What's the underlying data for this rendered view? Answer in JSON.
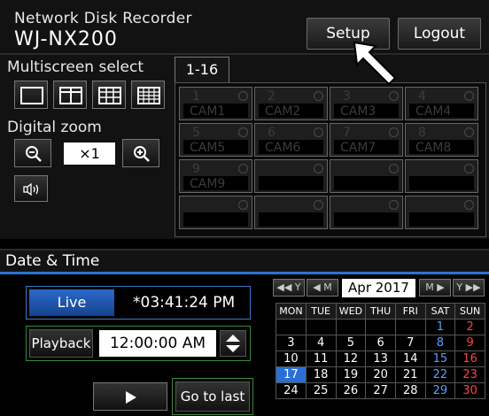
{
  "header": {
    "subtitle": "Network Disk Recorder",
    "title": "WJ-NX200",
    "setup_label": "Setup",
    "logout_label": "Logout"
  },
  "multiscreen": {
    "title": "Multiscreen select",
    "options": [
      "1-screen",
      "4-screen",
      "9-screen",
      "16-screen"
    ]
  },
  "digital_zoom": {
    "title": "Digital zoom",
    "value": "×1"
  },
  "camera_grid": {
    "tab_label": "1-16",
    "cells": [
      {
        "num": "1",
        "cam": "CAM1"
      },
      {
        "num": "2",
        "cam": "CAM2"
      },
      {
        "num": "3",
        "cam": "CAM3"
      },
      {
        "num": "4",
        "cam": "CAM4"
      },
      {
        "num": "5",
        "cam": "CAM5"
      },
      {
        "num": "6",
        "cam": "CAM6"
      },
      {
        "num": "7",
        "cam": "CAM7"
      },
      {
        "num": "8",
        "cam": "CAM8"
      },
      {
        "num": "9",
        "cam": "CAM9"
      },
      {
        "num": "",
        "cam": ""
      },
      {
        "num": "",
        "cam": ""
      },
      {
        "num": "",
        "cam": ""
      },
      {
        "num": "",
        "cam": ""
      },
      {
        "num": "",
        "cam": ""
      },
      {
        "num": "",
        "cam": ""
      },
      {
        "num": "",
        "cam": ""
      }
    ]
  },
  "date_time": {
    "title": "Date & Time",
    "live_label": "Live",
    "live_time": "*03:41:24 PM",
    "playback_label": "Playback",
    "playback_time": "12:00:00 AM",
    "go_to_last_label": "Go to last"
  },
  "calendar": {
    "prev_year": "◀◀ Y",
    "prev_month": "◀ M",
    "month_year": "Apr 2017",
    "next_month": "M ▶",
    "next_year": "Y ▶▶",
    "weekdays": [
      "MON",
      "TUE",
      "WED",
      "THU",
      "FRI",
      "SAT",
      "SUN"
    ],
    "weeks": [
      [
        "",
        "",
        "",
        "",
        "",
        "1",
        "2"
      ],
      [
        "3",
        "4",
        "5",
        "6",
        "7",
        "8",
        "9"
      ],
      [
        "10",
        "11",
        "12",
        "13",
        "14",
        "15",
        "16"
      ],
      [
        "17",
        "18",
        "19",
        "20",
        "21",
        "22",
        "23"
      ],
      [
        "24",
        "25",
        "26",
        "27",
        "28",
        "29",
        "30"
      ]
    ],
    "selected_day": "17",
    "colors": {
      "saturday": "#5aa0ff",
      "sunday": "#ff4444",
      "selected": "#2a6fd6"
    }
  },
  "colors": {
    "accent": "#2e73d1",
    "live_blue": "#2d68c8",
    "playback_green": "#3b8a3b"
  }
}
